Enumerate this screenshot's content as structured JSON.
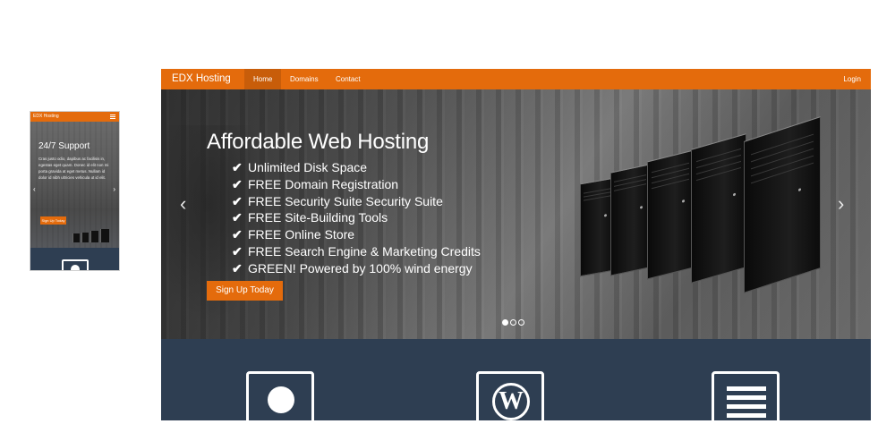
{
  "mobile": {
    "brand": "EDX Hosting",
    "slide_title": "24/7 Support",
    "slide_text": "Cras justo odio, dapibus ac facilisis in, egestas eget quam. Donec id elit non mi porta gravida at eget metus. Nullam id dolor id nibh ultricies vehicula ut id elit.",
    "signup_label": "Sign Up Today",
    "prev_glyph": "‹",
    "next_glyph": "›",
    "icons": {
      "menu": "hamburger-menu-icon",
      "feature": "user-icon"
    }
  },
  "desktop": {
    "nav": {
      "brand": "EDX Hosting",
      "items": [
        {
          "label": "Home",
          "active": true
        },
        {
          "label": "Domains",
          "active": false
        },
        {
          "label": "Contact",
          "active": false
        }
      ],
      "login_label": "Login"
    },
    "hero": {
      "title": "Affordable Web Hosting",
      "features": [
        "Unlimited Disk Space",
        "FREE Domain Registration",
        "FREE Security Suite Security Suite",
        "FREE Site-Building Tools",
        "FREE Online Store",
        "FREE Search Engine & Marketing Credits",
        "GREEN! Powered by 100% wind energy"
      ],
      "check_glyph": "✔",
      "signup_label": "Sign Up Today",
      "prev_glyph": "‹",
      "next_glyph": "›",
      "slides": {
        "count": 3,
        "active": 0
      }
    },
    "feature_icons": [
      "user-icon",
      "wordpress-icon",
      "server-icon"
    ],
    "wp_glyph": "W"
  },
  "colors": {
    "accent": "#e46b0c",
    "nav_active": "#c85d0a",
    "section_bg": "#2e3e52",
    "text_light": "#ffffff"
  }
}
